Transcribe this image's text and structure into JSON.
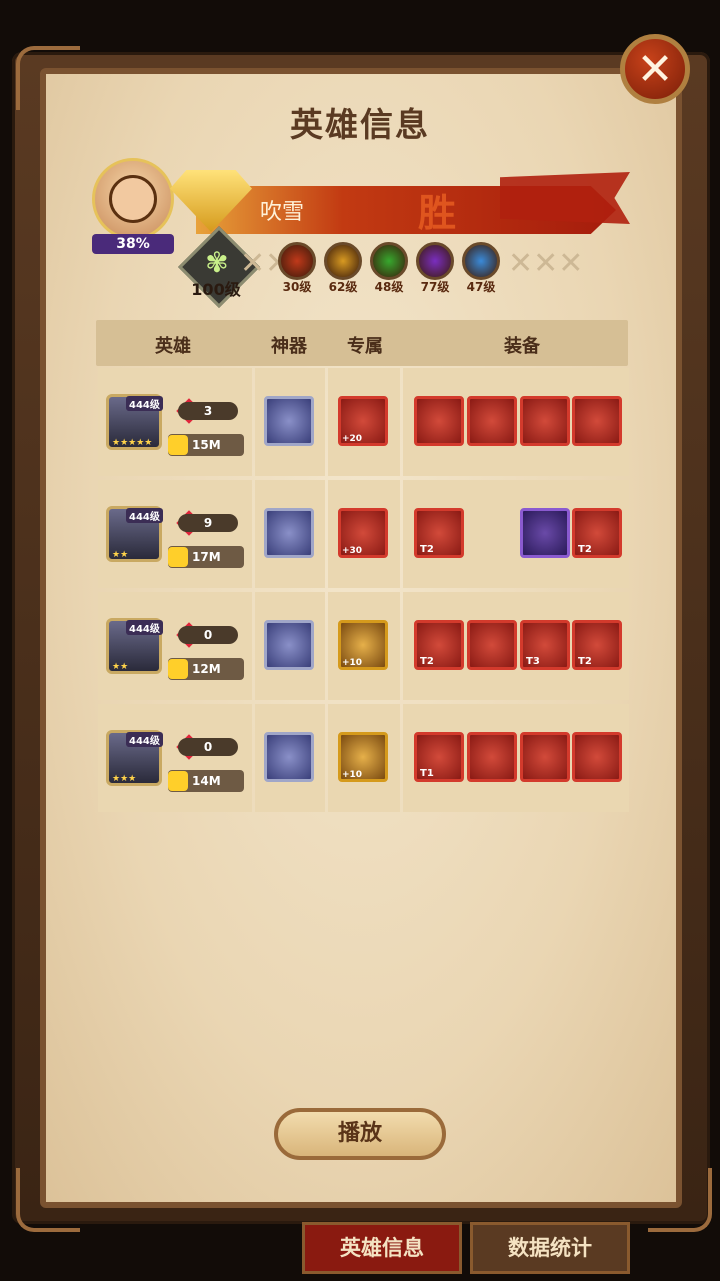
{
  "title": "英雄信息",
  "player": {
    "name": "吹雪",
    "progress": "38%",
    "result_mark": "胜",
    "level": "100级"
  },
  "factions": [
    {
      "icon": "flame-faction-icon",
      "level": "30级",
      "color": "#c0391a"
    },
    {
      "icon": "sun-faction-icon",
      "level": "62级",
      "color": "#d89a22"
    },
    {
      "icon": "leaf-faction-icon",
      "level": "48级",
      "color": "#37a82e"
    },
    {
      "icon": "moon-faction-icon",
      "level": "77级",
      "color": "#7a2ec0"
    },
    {
      "icon": "frost-faction-icon",
      "level": "47级",
      "color": "#3a8ad8"
    }
  ],
  "headers": {
    "hero": "英雄",
    "artifact": "神器",
    "exclusive": "专属",
    "equipment": "装备"
  },
  "heroes": [
    {
      "level": "444级",
      "stars": "★★★★★",
      "gems": "3",
      "power": "15M",
      "exclusive_plus": "+20",
      "equipment": [
        {
          "tier": ""
        },
        {
          "tier": ""
        },
        {
          "tier": ""
        },
        {
          "tier": ""
        }
      ]
    },
    {
      "level": "444级",
      "stars": "★★",
      "gems": "9",
      "power": "17M",
      "exclusive_plus": "+30",
      "equipment": [
        {
          "tier": "T2"
        },
        {
          "tier": ""
        },
        {
          "tier": "T2"
        }
      ]
    },
    {
      "level": "444级",
      "stars": "★★",
      "gems": "0",
      "power": "12M",
      "exclusive_plus": "+10",
      "equipment": [
        {
          "tier": "T2"
        },
        {
          "tier": ""
        },
        {
          "tier": "T3"
        },
        {
          "tier": "T2"
        }
      ]
    },
    {
      "level": "444级",
      "stars": "★★★",
      "gems": "0",
      "power": "14M",
      "exclusive_plus": "+10",
      "equipment": [
        {
          "tier": "T1"
        },
        {
          "tier": ""
        },
        {
          "tier": ""
        },
        {
          "tier": ""
        }
      ]
    }
  ],
  "buttons": {
    "play": "播放",
    "close": "✕"
  },
  "tabs": [
    {
      "label": "英雄信息"
    },
    {
      "label": "数据统计"
    }
  ]
}
